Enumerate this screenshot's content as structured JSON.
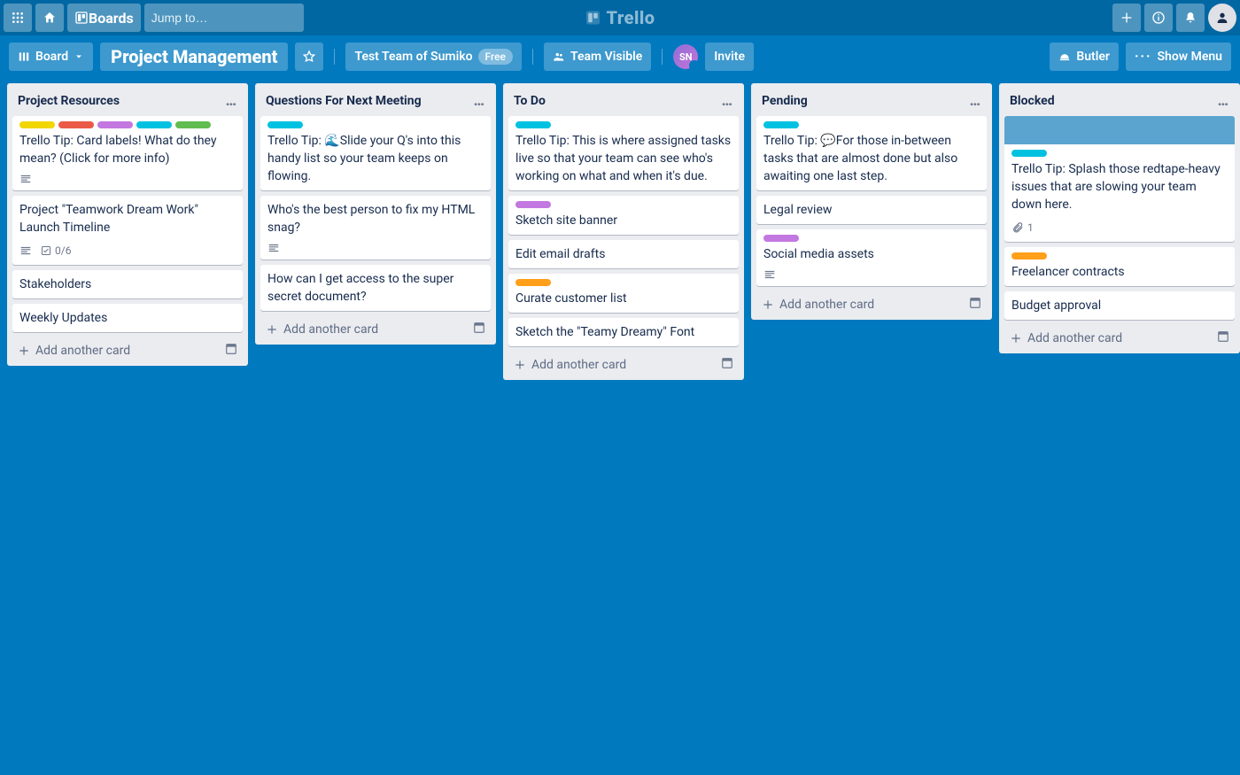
{
  "topnav": {
    "boards_label": "Boards",
    "search_placeholder": "Jump to…",
    "brand": "Trello"
  },
  "boardbar": {
    "view_label": "Board",
    "board_name": "Project Management",
    "team_label": "Test Team of Sumiko",
    "free_badge": "Free",
    "visibility_label": "Team Visible",
    "member_initials": "SN",
    "invite_label": "Invite",
    "butler_label": "Butler",
    "show_menu_label": "Show Menu"
  },
  "add_card_label": "Add another card",
  "lists": [
    {
      "title": "Project Resources",
      "cards": [
        {
          "labels": [
            "yellow",
            "red",
            "purple",
            "sky",
            "green"
          ],
          "text": "Trello Tip: Card labels! What do they mean? (Click for more info)",
          "desc": true
        },
        {
          "text": "Project \"Teamwork Dream Work\" Launch Timeline",
          "desc": true,
          "checklist": "0/6"
        },
        {
          "text": "Stakeholders"
        },
        {
          "text": "Weekly Updates"
        }
      ]
    },
    {
      "title": "Questions For Next Meeting",
      "cards": [
        {
          "labels": [
            "sky"
          ],
          "text": "Trello Tip: 🌊Slide your Q's into this handy list so your team keeps on flowing."
        },
        {
          "text": "Who's the best person to fix my HTML snag?",
          "desc": true
        },
        {
          "text": "How can I get access to the super secret document?"
        }
      ]
    },
    {
      "title": "To Do",
      "cards": [
        {
          "labels": [
            "sky"
          ],
          "text": "Trello Tip: This is where assigned tasks live so that your team can see who's working on what and when it's due."
        },
        {
          "labels": [
            "purple"
          ],
          "text": "Sketch site banner"
        },
        {
          "text": "Edit email drafts"
        },
        {
          "labels": [
            "orange"
          ],
          "text": "Curate customer list"
        },
        {
          "text": "Sketch the \"Teamy Dreamy\" Font"
        }
      ]
    },
    {
      "title": "Pending",
      "cards": [
        {
          "labels": [
            "sky"
          ],
          "text": "Trello Tip: 💬For those in-between tasks that are almost done but also awaiting one last step."
        },
        {
          "text": "Legal review"
        },
        {
          "labels": [
            "purple"
          ],
          "text": "Social media assets",
          "desc": true
        }
      ]
    },
    {
      "title": "Blocked",
      "cards": [
        {
          "cover": true,
          "labels": [
            "sky"
          ],
          "text": "Trello Tip: Splash those redtape-heavy issues that are slowing your team down here.",
          "attach": "1"
        },
        {
          "labels": [
            "orange"
          ],
          "text": "Freelancer contracts"
        },
        {
          "text": "Budget approval"
        }
      ]
    }
  ]
}
